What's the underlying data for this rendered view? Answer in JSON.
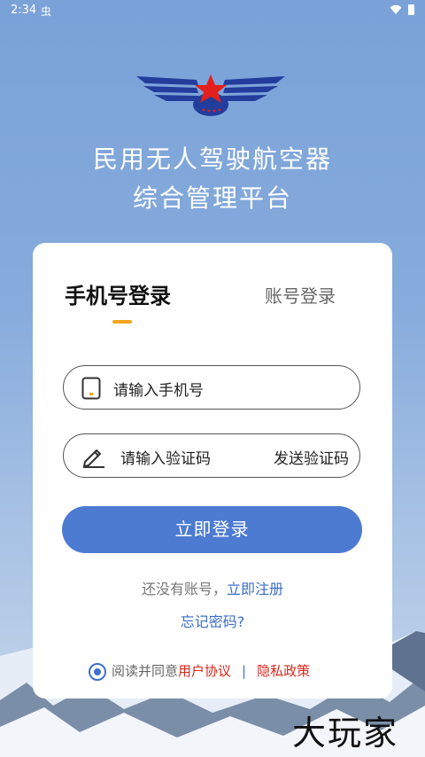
{
  "status_bar": {
    "time": "2:34",
    "notification_icon": "虫"
  },
  "app_title": {
    "line1": "民用无人驾驶航空器",
    "line2": "综合管理平台"
  },
  "tabs": [
    {
      "label": "手机号登录",
      "active": true
    },
    {
      "label": "账号登录",
      "active": false
    }
  ],
  "phone_field": {
    "placeholder": "请输入手机号",
    "icon": "phone-icon"
  },
  "code_field": {
    "placeholder": "请输入验证码",
    "icon": "pencil-icon",
    "send_label": "发送验证码"
  },
  "login_button": {
    "label": "立即登录"
  },
  "register": {
    "prompt": "还没有账号，",
    "link": "立即注册"
  },
  "forgot": {
    "label": "忘记密码?"
  },
  "agreement": {
    "prefix": "阅读并同意",
    "terms": "用户协议",
    "separator": "|",
    "privacy": "隐私政策",
    "checked": true
  },
  "watermark": "大玩家",
  "colors": {
    "primary": "#4d7bd2",
    "accent": "#f2a51c",
    "link": "#3a6dc6",
    "danger": "#d9281c",
    "background_top": "#7aa2d8"
  }
}
